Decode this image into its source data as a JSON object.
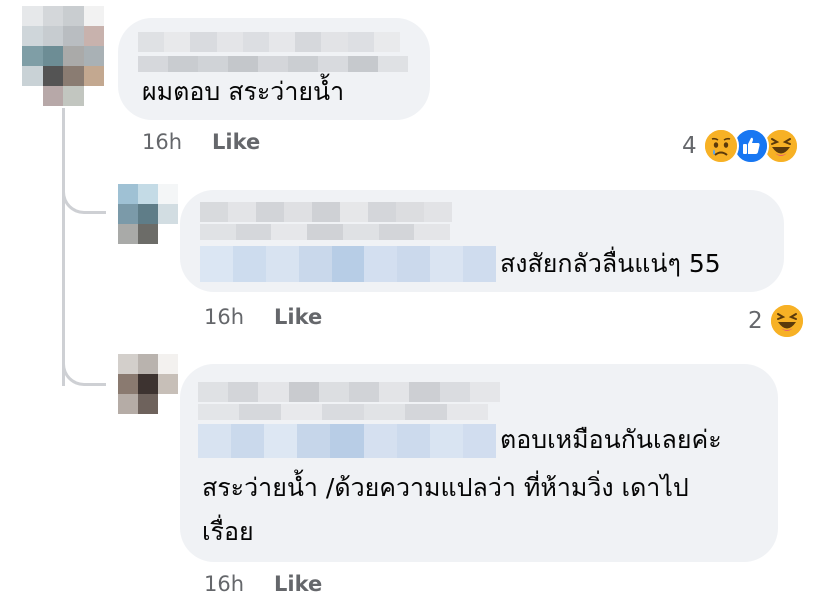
{
  "comments": [
    {
      "text": "ผมตอบ สระว่ายน้ำ",
      "time": "16h",
      "like_label": "Like",
      "reactions": {
        "count": "4",
        "types": [
          "sad-reaction",
          "like-reaction",
          "haha-reaction"
        ]
      }
    },
    {
      "text": "สงสัยกลัวลื่นแน่ๆ  55",
      "time": "16h",
      "like_label": "Like",
      "reactions": {
        "count": "2",
        "types": [
          "haha-reaction"
        ]
      }
    },
    {
      "text_lines": [
        "ตอบเหมือนกันเลยค่ะ",
        "สระว่ายน้ำ /ด้วยความแปลว่า ที่ห้ามวิ่ง เดาไป",
        "เรื่อย"
      ],
      "time": "16h",
      "like_label": "Like"
    }
  ],
  "colors": {
    "bubble": "#f0f2f5",
    "thread_line": "#ced0d4",
    "meta_text": "#65676b",
    "like_blue": "#1877f2",
    "emoji_yellow": "#f7b125"
  }
}
